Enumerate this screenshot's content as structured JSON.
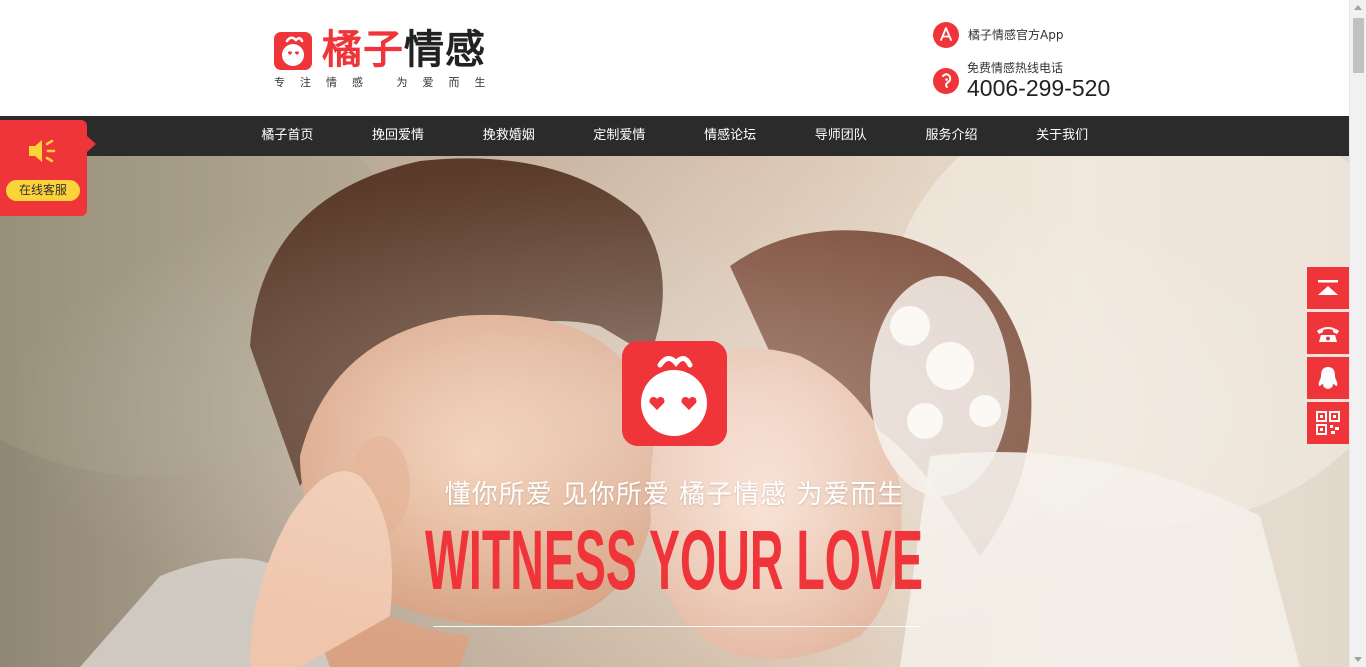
{
  "header": {
    "logo": {
      "title_part1": "橘子",
      "title_part2": "情感",
      "tagline": "专注情感 为爱而生"
    },
    "app_link": {
      "icon": "app-store-icon",
      "text": "橘子情感官方App"
    },
    "hotline": {
      "icon": "phone-ear-icon",
      "label": "免费情感热线电话",
      "number": "4006-299-520"
    }
  },
  "nav": {
    "items": [
      {
        "label": "橘子首页"
      },
      {
        "label": "挽回爱情"
      },
      {
        "label": "挽救婚姻"
      },
      {
        "label": "定制爱情"
      },
      {
        "label": "情感论坛"
      },
      {
        "label": "导师团队"
      },
      {
        "label": "服务介绍"
      },
      {
        "label": "关于我们"
      }
    ]
  },
  "hero": {
    "slogan": "懂你所爱 见你所爱 橘子情感 为爱而生",
    "title": "WITNESS YOUR LOVE"
  },
  "float_service": {
    "icon": "speaker-icon",
    "button_label": "在线客服"
  },
  "float_right": {
    "buttons": [
      {
        "icon": "back-to-top-icon"
      },
      {
        "icon": "telephone-icon"
      },
      {
        "icon": "qq-penguin-icon"
      },
      {
        "icon": "qr-code-icon"
      }
    ]
  },
  "colors": {
    "brand_red": "#f0353a",
    "nav_bg": "#2b2b2b",
    "service_yellow": "#fdd33a"
  }
}
